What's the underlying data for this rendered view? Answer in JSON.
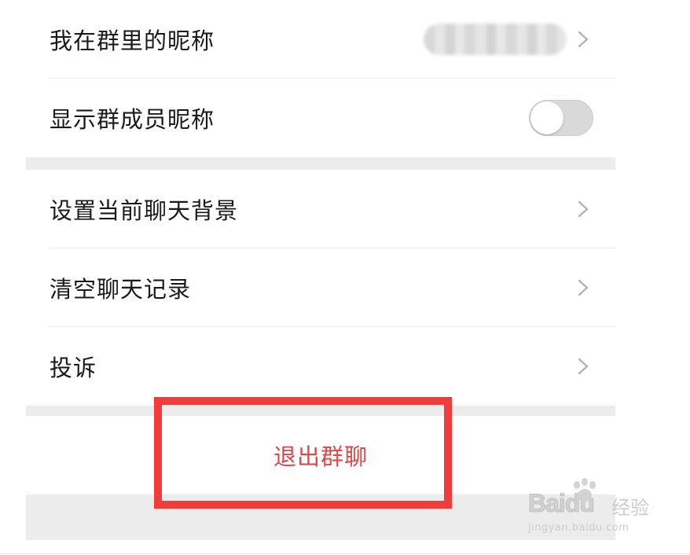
{
  "settings_group_1": {
    "items": [
      {
        "label": "我在群里的昵称"
      },
      {
        "label": "显示群成员昵称",
        "toggle_on": false
      }
    ]
  },
  "settings_group_2": {
    "items": [
      {
        "label": "设置当前聊天背景"
      },
      {
        "label": "清空聊天记录"
      },
      {
        "label": "投诉"
      }
    ]
  },
  "exit_button": {
    "label": "退出群聊",
    "color": "#e04646"
  },
  "highlight_color": "#f23b3b",
  "watermark": {
    "brand": "Baidu",
    "product": "经验",
    "url": "jingyan.baidu.com"
  }
}
